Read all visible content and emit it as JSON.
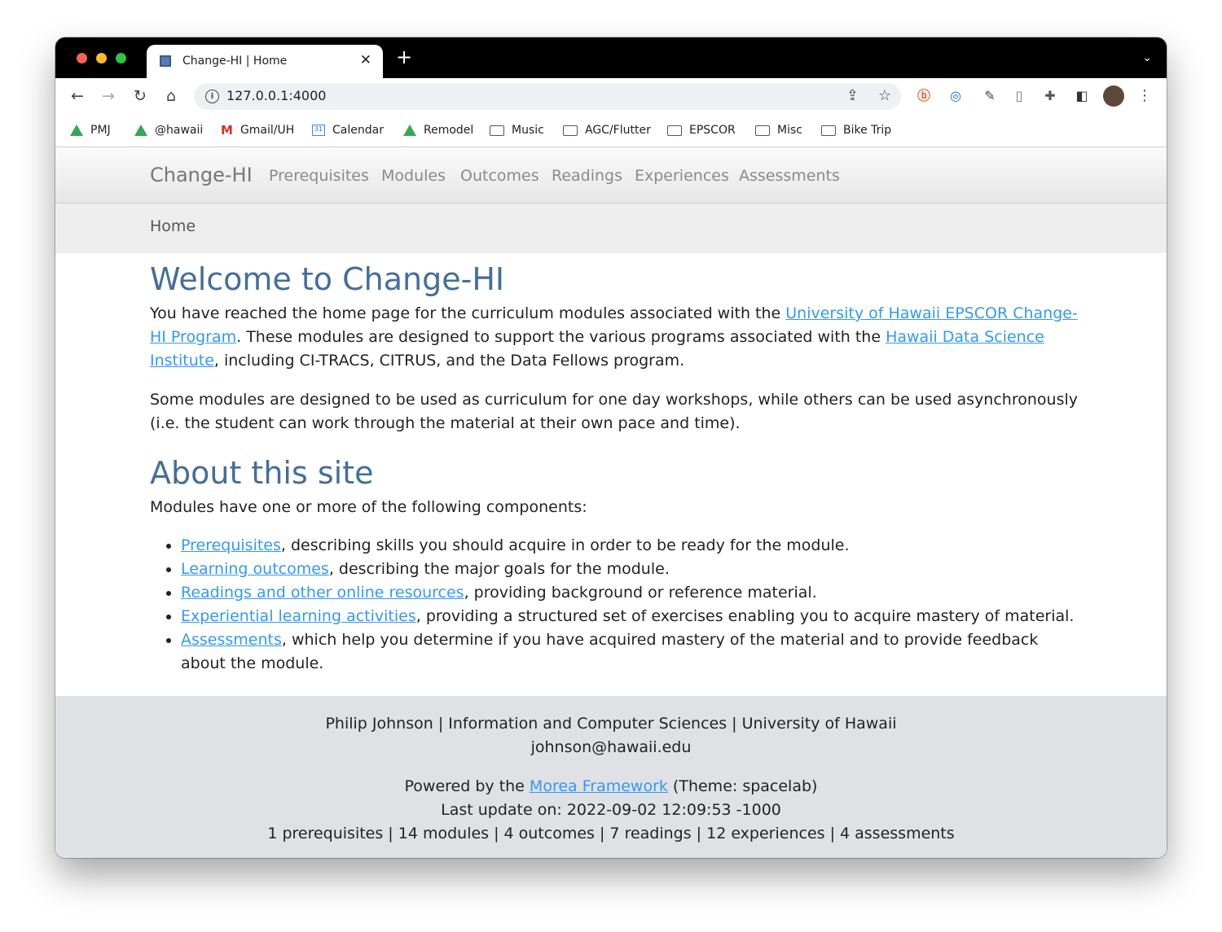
{
  "browser": {
    "tab_title": "Change-HI | Home",
    "url": "127.0.0.1:4000",
    "bookmarks": [
      "PMJ",
      "@hawaii",
      "Gmail/UH",
      "Calendar",
      "Remodel",
      "Music",
      "AGC/Flutter",
      "EPSCOR",
      "Misc",
      "Bike Trip"
    ],
    "calendar_icon_text": "31"
  },
  "navbar": {
    "brand": "Change-HI",
    "links": [
      "Prerequisites",
      "Modules",
      "Outcomes",
      "Readings",
      "Experiences",
      "Assessments"
    ]
  },
  "breadcrumb": "Home",
  "main": {
    "heading": "Welcome to Change-HI",
    "intro": {
      "t1": "You have reached the home page for the curriculum modules associated with the ",
      "link1": "University of Hawaii EPSCOR Change-HI Program",
      "t2": ". These modules are designed to support the various programs associated with the ",
      "link2": "Hawaii Data Science Institute",
      "t3": ", including CI-TRACS, CITRUS, and the Data Fellows program."
    },
    "para2": "Some modules are designed to be used as curriculum for one day workshops, while others can be used asynchronously (i.e. the student can work through the material at their own pace and time).",
    "about_heading": "About this site",
    "components_intro": "Modules have one or more of the following components:",
    "components": [
      {
        "link": "Prerequisites",
        "text": ", describing skills you should acquire in order to be ready for the module."
      },
      {
        "link": "Learning outcomes",
        "text": ", describing the major goals for the module."
      },
      {
        "link": "Readings and other online resources",
        "text": ", providing background or reference material."
      },
      {
        "link": "Experiential learning activities",
        "text": ", providing a structured set of exercises enabling you to acquire mastery of material."
      },
      {
        "link": "Assessments",
        "text": ", which help you determine if you have acquired mastery of the material and to provide feedback about the module."
      }
    ]
  },
  "footer": {
    "credits": "Philip Johnson | Information and Computer Sciences | University of Hawaii",
    "email": "johnson@hawaii.edu",
    "powered_prefix": "Powered by the ",
    "powered_link": "Morea Framework",
    "powered_suffix": " (Theme: spacelab)",
    "last_update": "Last update on: 2022-09-02 12:09:53 -1000",
    "stats": "1 prerequisites | 14 modules | 4 outcomes | 7 readings | 12 experiences | 4 assessments"
  },
  "colors": {
    "heading": "#446e9b",
    "link": "#3399f3",
    "footer_bg": "#dfe1e5",
    "breadcrumb_bg": "#eeeeee"
  }
}
